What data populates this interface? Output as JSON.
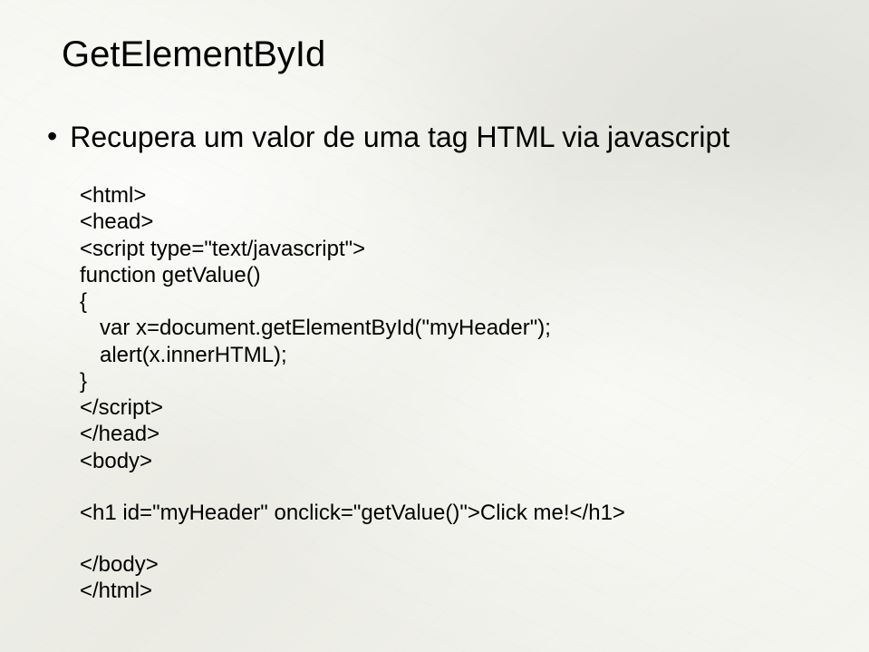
{
  "title": "GetElementById",
  "bullet": {
    "text": "Recupera um valor de uma tag HTML via javascript"
  },
  "code": {
    "l1": "<html>",
    "l2": "<head>",
    "l3": "<script type=\"text/javascript\">",
    "l4": "function getValue()",
    "l5": "{",
    "l6": "var x=document.getElementById(\"myHeader\");",
    "l7": "alert(x.innerHTML);",
    "l8": "}",
    "l9": "</script>",
    "l10": "</head>",
    "l11": "<body>",
    "l12": "<h1 id=\"myHeader\" onclick=\"getValue()\">Click me!</h1>",
    "l13": "</body>",
    "l14": "</html>"
  }
}
